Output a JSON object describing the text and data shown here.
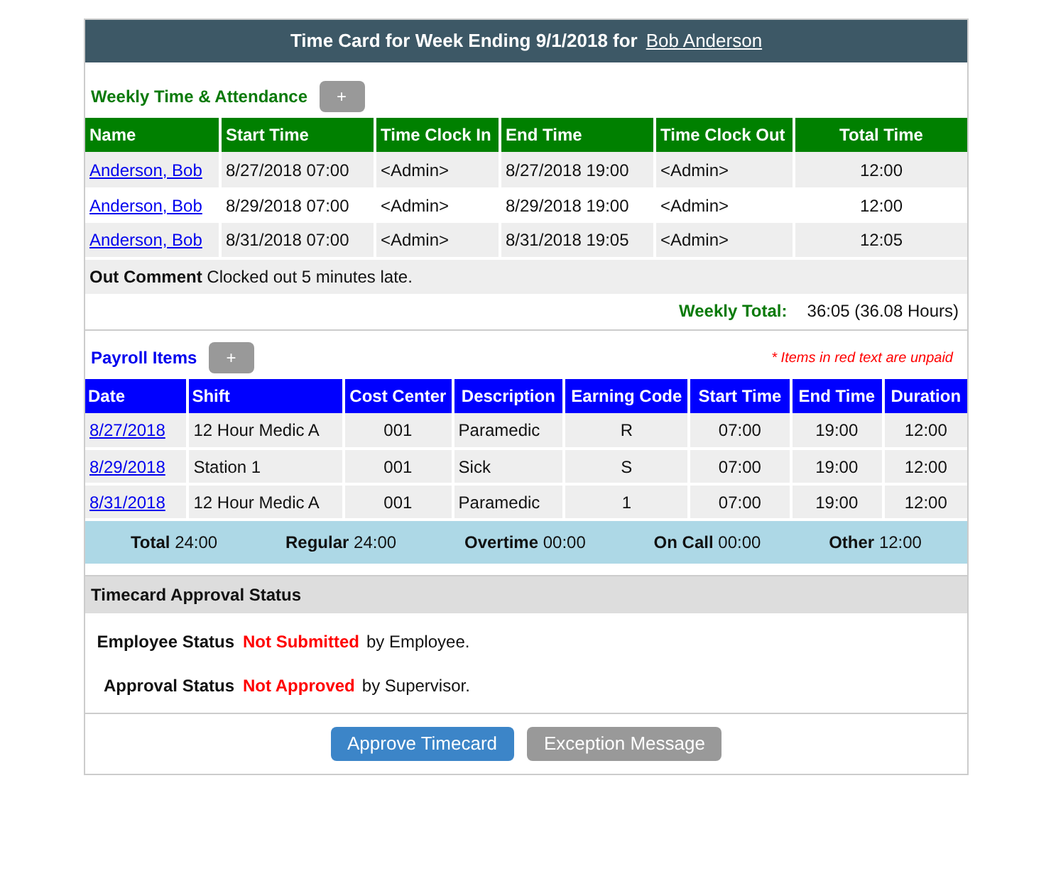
{
  "header": {
    "title": "Time Card for Week Ending 9/1/2018 for",
    "employee_link": "Bob Anderson"
  },
  "attendance": {
    "title": "Weekly Time & Attendance",
    "add_button": "+",
    "columns": [
      "Name",
      "Start Time",
      "Time Clock In",
      "End Time",
      "Time Clock Out",
      "Total Time"
    ],
    "rows": [
      {
        "name": "Anderson, Bob",
        "start": "8/27/2018 07:00",
        "clock_in": "<Admin>",
        "end": "8/27/2018 19:00",
        "clock_out": "<Admin>",
        "total": "12:00"
      },
      {
        "name": "Anderson, Bob",
        "start": "8/29/2018 07:00",
        "clock_in": "<Admin>",
        "end": "8/29/2018 19:00",
        "clock_out": "<Admin>",
        "total": "12:00"
      },
      {
        "name": "Anderson, Bob",
        "start": "8/31/2018 07:00",
        "clock_in": "<Admin>",
        "end": "8/31/2018 19:05",
        "clock_out": "<Admin>",
        "total": "12:05"
      }
    ],
    "comment": "**Out Comment** Clocked out 5 minutes late.",
    "weekly_total_label": "Weekly Total:",
    "weekly_total": "36:05 (36.08 Hours)"
  },
  "payroll": {
    "title": "Payroll Items",
    "add_button": "+",
    "note": "* Items in red text are unpaid",
    "columns": [
      "Date",
      "Shift",
      "Cost Center",
      "Description",
      "Earning Code",
      "Start Time",
      "End Time",
      "Duration"
    ],
    "rows": [
      {
        "date": "8/27/2018",
        "shift": "12 Hour Medic A",
        "cost_center": "001",
        "description": "Paramedic",
        "earning_code": "R",
        "start": "07:00",
        "end": "19:00",
        "duration": "12:00"
      },
      {
        "date": "8/29/2018",
        "shift": "Station 1",
        "cost_center": "001",
        "description": "Sick",
        "earning_code": "S",
        "start": "07:00",
        "end": "19:00",
        "duration": "12:00"
      },
      {
        "date": "8/31/2018",
        "shift": "12 Hour Medic A",
        "cost_center": "001",
        "description": "Paramedic",
        "earning_code": "1",
        "start": "07:00",
        "end": "19:00",
        "duration": "12:00"
      }
    ],
    "totals": [
      "**Total** 24:00",
      "**Regular** 24:00",
      "**Overtime** 00:00",
      "**On Call** 00:00",
      "**Other** 12:00"
    ]
  },
  "approval": {
    "title": "Timecard Approval Status",
    "rows": [
      {
        "label": "Employee Status",
        "status": "Not Submitted",
        "suffix": "by Employee."
      },
      {
        "label": "Approval Status",
        "status": "Not Approved",
        "suffix": "by Supervisor."
      }
    ]
  },
  "buttons": [
    {
      "label": "Approve Timecard",
      "kind": "primary"
    },
    {
      "label": "Exception Message",
      "kind": "secondary"
    }
  ]
}
